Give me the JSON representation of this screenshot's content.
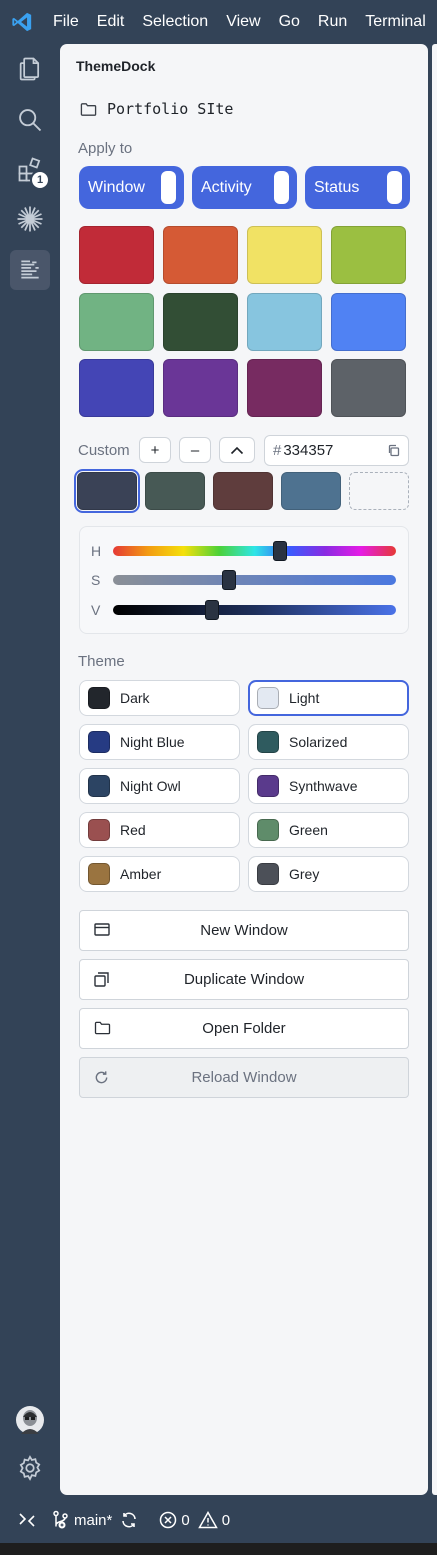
{
  "menubar": {
    "items": [
      "File",
      "Edit",
      "Selection",
      "View",
      "Go",
      "Run",
      "Terminal"
    ]
  },
  "activity_bar": {
    "items": [
      {
        "icon": "files-icon"
      },
      {
        "icon": "search-icon"
      },
      {
        "icon": "extensions-icon",
        "badge": "1"
      },
      {
        "icon": "spark-icon"
      },
      {
        "icon": "themedock-icon",
        "active": true
      }
    ],
    "bottom": [
      {
        "icon": "avatar"
      },
      {
        "icon": "gear-icon"
      }
    ]
  },
  "panel": {
    "title": "ThemeDock",
    "folder": "Portfolio SIte",
    "apply_to": {
      "label": "Apply to",
      "toggles": [
        "Window",
        "Activity",
        "Status"
      ]
    },
    "swatches": [
      "#c12b38",
      "#d55a35",
      "#f1e264",
      "#9bbf41",
      "#71b383",
      "#324e35",
      "#87c5df",
      "#5082f3",
      "#4445b5",
      "#6a3697",
      "#772b61",
      "#5d6268"
    ],
    "custom": {
      "label": "Custom",
      "plus": "+",
      "minus": "–",
      "up": "^",
      "hash": "#",
      "hex": "334357",
      "swatches": [
        "#3a4256",
        "#475955",
        "#5f3d3d",
        "#4e7290"
      ]
    },
    "sliders": {
      "h_label": "H",
      "s_label": "S",
      "v_label": "V",
      "h_value": 0.59,
      "s_value": 0.41,
      "v_value": 0.35
    },
    "theme": {
      "label": "Theme",
      "options": [
        {
          "name": "Dark",
          "color": "#22262c"
        },
        {
          "name": "Light",
          "color": "#e3e9f2",
          "selected": true
        },
        {
          "name": "Night Blue",
          "color": "#263b83"
        },
        {
          "name": "Solarized",
          "color": "#2f5b5f"
        },
        {
          "name": "Night Owl",
          "color": "#2c4463"
        },
        {
          "name": "Synthwave",
          "color": "#5a3a8c"
        },
        {
          "name": "Red",
          "color": "#9a5050"
        },
        {
          "name": "Green",
          "color": "#5f8c6a"
        },
        {
          "name": "Amber",
          "color": "#9a7440"
        },
        {
          "name": "Grey",
          "color": "#4c5058"
        }
      ]
    },
    "actions": {
      "new_window": "New Window",
      "duplicate_window": "Duplicate Window",
      "open_folder": "Open Folder",
      "reload_window": "Reload Window"
    }
  },
  "statusbar": {
    "branch": "main*",
    "errors": "0",
    "warnings": "0"
  },
  "colors": {
    "accent": "#4466dd",
    "chrome": "#334357",
    "panel": "#f5f6f8"
  }
}
